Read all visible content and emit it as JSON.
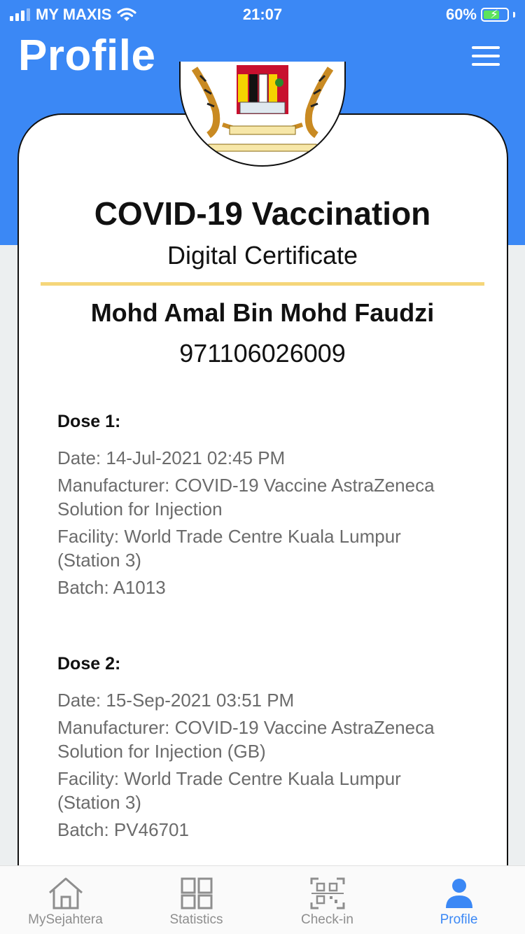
{
  "status_bar": {
    "carrier": "MY MAXIS",
    "time": "21:07",
    "battery": "60%"
  },
  "header": {
    "title": "Profile",
    "menu_icon": "hamburger-menu-icon"
  },
  "certificate": {
    "emblem": "malaysia-coat-of-arms",
    "title": "COVID-19 Vaccination",
    "subtitle": "Digital Certificate",
    "holder_name": "Mohd Amal Bin Mohd Faudzi",
    "holder_id": "971106026009",
    "doses": [
      {
        "heading": "Dose 1:",
        "date": "Date: 14-Jul-2021 02:45 PM",
        "manufacturer_1": "Manufacturer: COVID-19 Vaccine AstraZeneca",
        "manufacturer_2": "Solution for Injection",
        "facility_1": "Facility: World Trade Centre Kuala Lumpur",
        "facility_2": "(Station 3)",
        "batch": "Batch: A1013"
      },
      {
        "heading": "Dose 2:",
        "date": "Date: 15-Sep-2021 03:51 PM",
        "manufacturer_1": "Manufacturer: COVID-19 Vaccine AstraZeneca",
        "manufacturer_2": "Solution for Injection (GB)",
        "facility_1": "Facility: World Trade Centre Kuala Lumpur",
        "facility_2": "(Station 3)",
        "batch": "Batch: PV46701"
      }
    ]
  },
  "tabbar": {
    "tabs": [
      {
        "label": "MySejahtera",
        "icon": "home-icon",
        "active": false
      },
      {
        "label": "Statistics",
        "icon": "grid-icon",
        "active": false
      },
      {
        "label": "Check-in",
        "icon": "qr-scan-icon",
        "active": false
      },
      {
        "label": "Profile",
        "icon": "person-icon",
        "active": true
      }
    ]
  },
  "colors": {
    "brand_blue": "#3b88f5",
    "gold_divider": "#f5d67a",
    "detail_gray": "#6b6b6b"
  }
}
